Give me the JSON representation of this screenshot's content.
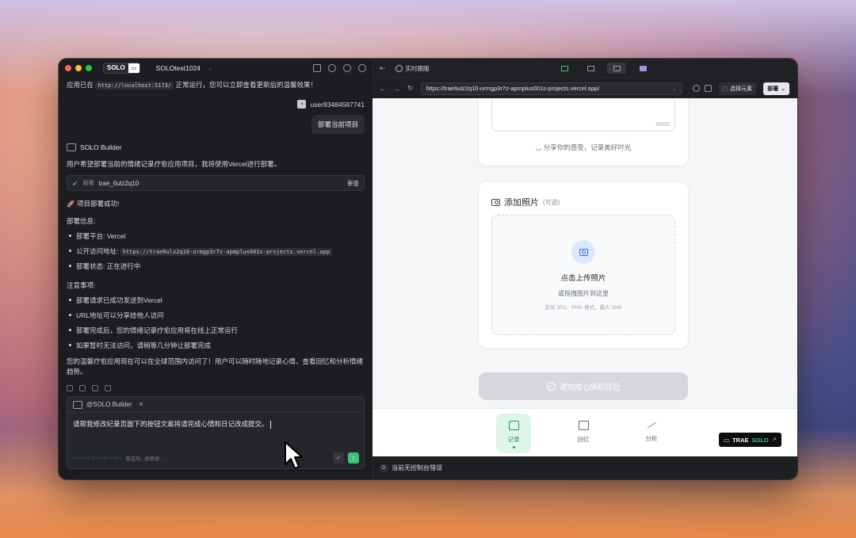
{
  "app": {
    "brand": "SOLO",
    "project_name": "SOLOtest1024"
  },
  "chat": {
    "system_line_prefix": "应用已在",
    "system_line_code": "http://localhost:5173/",
    "system_line_suffix": "正常运行，您可以立即查看更新后的温馨效果！",
    "user_name": "user83484587741",
    "user_message": "部署当前项目",
    "builder_name": "SOLO Builder",
    "builder_intro": "用户希望部署当前的情绪记录疗愈应用项目，我将使用Vercel进行部署。",
    "deploy_card": {
      "tag": "部署",
      "name": "trae_6ulz2q10",
      "action": "审查"
    },
    "success_line": "🚀 项目部署成功!",
    "info_title": "部署信息:",
    "info_items": {
      "platform": "部署平台: Vercel",
      "url_label": "公开访问地址:",
      "url_code": "https://trae6ulz2q10-ormgp3r7z-apmplus001s-projects.vercel.app",
      "status": "部署状态: 正在进行中"
    },
    "notes_title": "注意事项:",
    "notes": [
      "部署请求已成功发送到Vercel",
      "URL地址可以分享给他人访问",
      "部署完成后，您的情绪记录疗愈应用将在线上正常运行",
      "如果暂时无法访问，请稍等几分钟让部署完成"
    ],
    "closing": "您的温馨疗愈应用现在可以在全球范围内访问了！用户可以随时随地记录心情、查看回忆和分析情绪趋势。"
  },
  "composer": {
    "mention": "@SOLO Builder",
    "text": "请帮我修改纪录页面下的按钮文案将请完成心情和日记改成提交。",
    "thinking_dots": "·····:·:···:···:··",
    "thinking_label": "我在听, 请继续 ..."
  },
  "browser": {
    "live_label": "实时跟随",
    "url": "https://trae6ulz2q10-ormgp3r7z-apmplus001s-projects.vercel.app/",
    "select_element": "选择元素",
    "deploy": "部署"
  },
  "preview": {
    "counter": "0/500",
    "share_hint": "分享你的感受，记录美好时光",
    "photo_title": "添加照片",
    "photo_optional": "(可选)",
    "upload_title": "点击上传照片",
    "upload_sub": "或拖拽图片到这里",
    "upload_hint": "支持 JPG、PNG 格式，最大 5MB",
    "submit_label": "请完成心情和日记",
    "nav": {
      "record": "记录",
      "memory": "回忆",
      "analysis": "分析"
    },
    "trae_badge_trae": "TRAE",
    "trae_badge_solo": "SOLO"
  },
  "console": {
    "count": "0",
    "message": "当前无控制台错误"
  },
  "colors": {
    "accent_green": "#3fc27c",
    "panel_dark": "#1c1d20",
    "preview_bg": "#f4f6f8"
  }
}
